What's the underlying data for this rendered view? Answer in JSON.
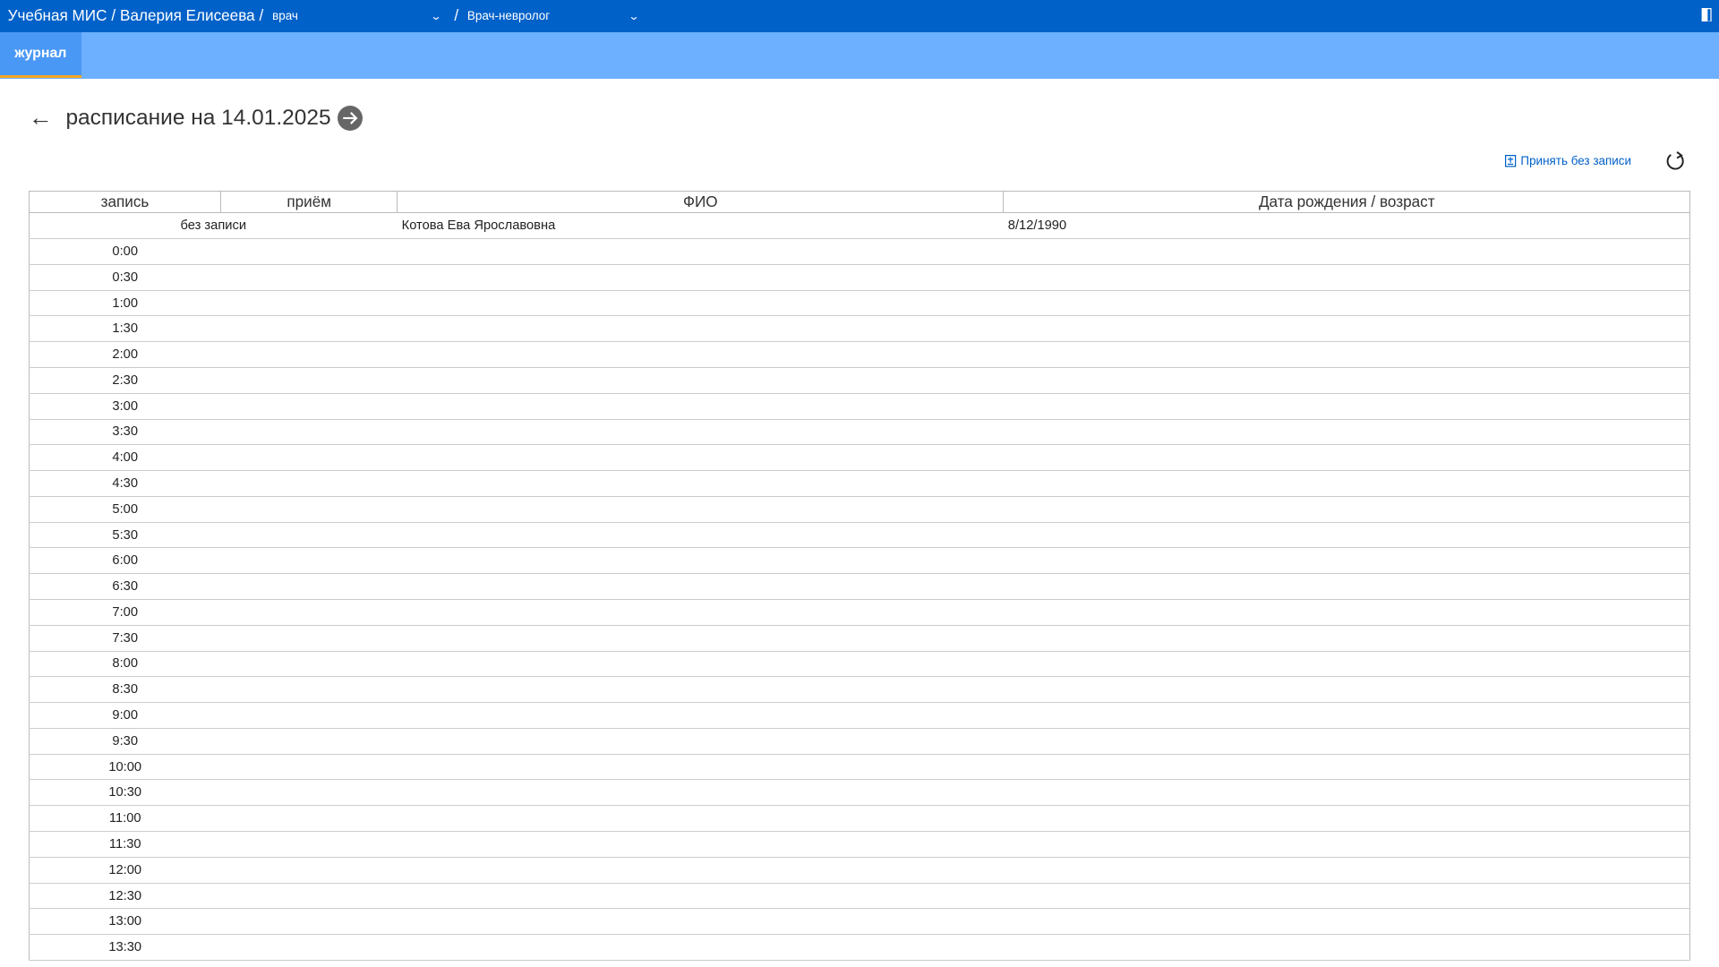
{
  "header": {
    "app_name": "Учебная МИС",
    "user_name": "Валерия Елисеева",
    "role": "врач",
    "specialty": "Врач-невролог"
  },
  "tabs": [
    {
      "label": "журнал",
      "active": true
    }
  ],
  "schedule": {
    "title": "расписание на 14.01.2025",
    "accept_without_appointment": "Принять без записи",
    "columns": [
      "запись",
      "приём",
      "ФИО",
      "Дата рождения / возраст"
    ],
    "walk_in": {
      "label": "без записи",
      "fio": "Котова Ева Ярославовна",
      "birth": "8/12/1990"
    },
    "slots": [
      "0:00",
      "0:30",
      "1:00",
      "1:30",
      "2:00",
      "2:30",
      "3:00",
      "3:30",
      "4:00",
      "4:30",
      "5:00",
      "5:30",
      "6:00",
      "6:30",
      "7:00",
      "7:30",
      "8:00",
      "8:30",
      "9:00",
      "9:30",
      "10:00",
      "10:30",
      "11:00",
      "11:30",
      "12:00",
      "12:30",
      "13:00",
      "13:30"
    ]
  },
  "colors": {
    "topbar": "#0061c9",
    "tabbar": "#6cb0ff",
    "tab_accent": "#f5a623"
  }
}
